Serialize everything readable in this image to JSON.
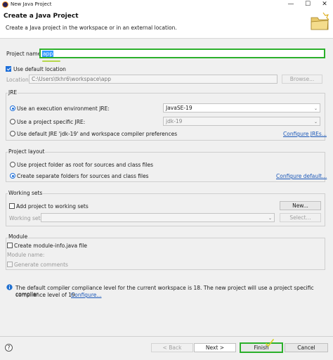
{
  "window": {
    "title": "New Java Project",
    "minimize": "—",
    "maximize": "☐",
    "close": "✕"
  },
  "header": {
    "title": "Create a Java Project",
    "description": "Create a Java project in the workspace or in an external location."
  },
  "project_name": {
    "label": "Project name:",
    "value": "app"
  },
  "location": {
    "use_default_label": "Use default location",
    "label": "Location:",
    "value": "C:\\Users\\tkhr6\\workspace\\app",
    "browse": "Browse..."
  },
  "jre": {
    "title": "JRE",
    "exec_env_label": "Use an execution environment JRE:",
    "exec_env_value": "JavaSE-19",
    "project_specific_label": "Use a project specific JRE:",
    "project_specific_value": "jdk-19",
    "default_label": "Use default JRE 'jdk-19' and workspace compiler preferences",
    "configure_link": "Configure JREs..."
  },
  "layout": {
    "title": "Project layout",
    "root_label": "Use project folder as root for sources and class files",
    "separate_label": "Create separate folders for sources and class files",
    "configure_link": "Configure default..."
  },
  "working_sets": {
    "title": "Working sets",
    "add_label": "Add project to working sets",
    "new_button": "New...",
    "sets_label": "Working sets:",
    "select_button": "Select..."
  },
  "module": {
    "title": "Module",
    "create_label": "Create module-info.java file",
    "name_label": "Module name:",
    "comments_label": "Generate comments"
  },
  "info": {
    "message": "The default compiler compliance level for the current workspace is 18. The new project will use a project specific compiler",
    "message2": "compliance level of 19.",
    "link": "Configure..."
  },
  "buttons": {
    "help": "?",
    "back": "< Back",
    "next": "Next >",
    "finish": "Finish",
    "cancel": "Cancel"
  },
  "colors": {
    "accent": "#1e6fd9",
    "highlight": "#2bb02b",
    "link": "#1a57b8"
  }
}
